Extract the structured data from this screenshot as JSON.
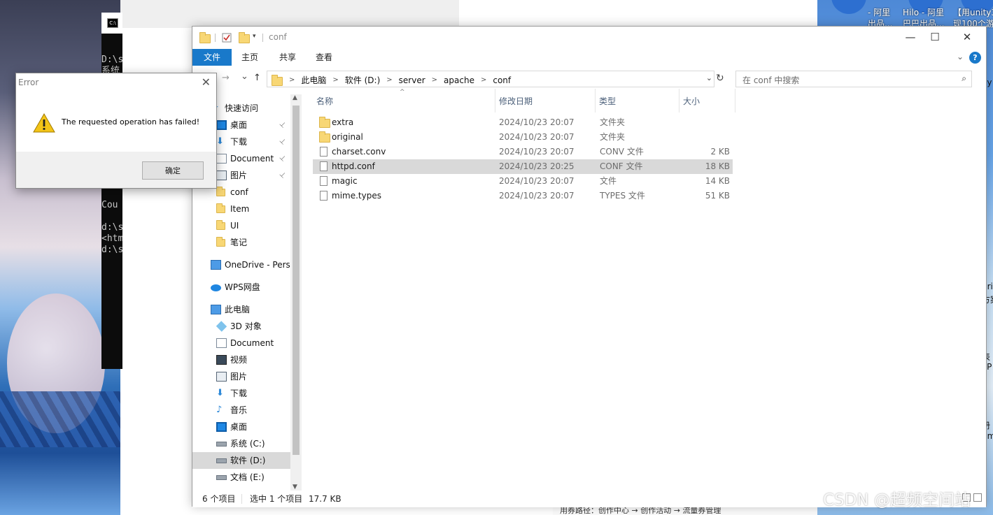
{
  "background": {
    "cmd_lines_top": "D:\\s\n系统",
    "cmd_lines_bottom": "Cou\n\nd:\\s\n<htm\nd:\\s",
    "desktop_labels": [
      "- 阿里\n出品...",
      "Hilo - 阿里\n巴巴出品...",
      "【用unity3\n现100个游"
    ],
    "edge_texts": [
      "ey",
      "pri",
      "方案",
      "表",
      "IJP",
      "册",
      "hm"
    ],
    "bottom_strip": "用券路径：创作中心 → 创作活动 → 流量券管理",
    "watermark": "CSDN @超频空间站"
  },
  "error_dialog": {
    "title": "Error",
    "message": "The requested operation has failed!",
    "ok_label": "确定",
    "close_glyph": "✕"
  },
  "explorer": {
    "window_title": "conf",
    "controls": {
      "minimize": "—",
      "maximize": "☐",
      "close": "✕"
    },
    "ribbon_tabs": [
      "文件",
      "主页",
      "共享",
      "查看"
    ],
    "help": "?",
    "nav": {
      "back": "←",
      "forward": "→",
      "recent": "⌄",
      "up": "↑"
    },
    "breadcrumbs": [
      "此电脑",
      "软件 (D:)",
      "server",
      "apache",
      "conf"
    ],
    "search_placeholder": "在 conf 中搜索",
    "navpane": [
      {
        "label": "快速访问",
        "icon": "star-icon"
      },
      {
        "label": "桌面",
        "icon": "desktop-icon",
        "pinned": true
      },
      {
        "label": "下载",
        "icon": "download-icon",
        "pinned": true
      },
      {
        "label": "Document",
        "icon": "document-icon",
        "pinned": true
      },
      {
        "label": "图片",
        "icon": "picture-icon",
        "pinned": true
      },
      {
        "label": "conf",
        "icon": "folder-icon"
      },
      {
        "label": "Item",
        "icon": "folder-icon"
      },
      {
        "label": "UI",
        "icon": "folder-icon"
      },
      {
        "label": "笔记",
        "icon": "folder-icon"
      },
      {
        "label": "OneDrive - Perso",
        "icon": "onedrive-icon"
      },
      {
        "label": "WPS网盘",
        "icon": "cloud-icon"
      },
      {
        "label": "此电脑",
        "icon": "pc-icon"
      },
      {
        "label": "3D 对象",
        "icon": "3d-objects-icon"
      },
      {
        "label": "Document",
        "icon": "document-icon"
      },
      {
        "label": "视频",
        "icon": "video-icon"
      },
      {
        "label": "图片",
        "icon": "picture-icon"
      },
      {
        "label": "下载",
        "icon": "download-icon"
      },
      {
        "label": "音乐",
        "icon": "music-icon"
      },
      {
        "label": "桌面",
        "icon": "desktop-icon"
      },
      {
        "label": "系统 (C:)",
        "icon": "drive-icon"
      },
      {
        "label": "软件 (D:)",
        "icon": "drive-icon",
        "selected": true
      },
      {
        "label": "文档 (E:)",
        "icon": "drive-icon"
      }
    ],
    "columns": [
      "名称",
      "修改日期",
      "类型",
      "大小"
    ],
    "files": [
      {
        "name": "extra",
        "date": "2024/10/23 20:07",
        "type": "文件夹",
        "size": "",
        "kind": "folder"
      },
      {
        "name": "original",
        "date": "2024/10/23 20:07",
        "type": "文件夹",
        "size": "",
        "kind": "folder"
      },
      {
        "name": "charset.conv",
        "date": "2024/10/23 20:07",
        "type": "CONV 文件",
        "size": "2 KB",
        "kind": "file"
      },
      {
        "name": "httpd.conf",
        "date": "2024/10/23 20:25",
        "type": "CONF 文件",
        "size": "18 KB",
        "kind": "file",
        "selected": true
      },
      {
        "name": "magic",
        "date": "2024/10/23 20:07",
        "type": "文件",
        "size": "14 KB",
        "kind": "file"
      },
      {
        "name": "mime.types",
        "date": "2024/10/23 20:07",
        "type": "TYPES 文件",
        "size": "51 KB",
        "kind": "file"
      }
    ],
    "status": {
      "count": "6 个项目",
      "selected": "选中 1 个项目",
      "size": "17.7 KB"
    }
  }
}
